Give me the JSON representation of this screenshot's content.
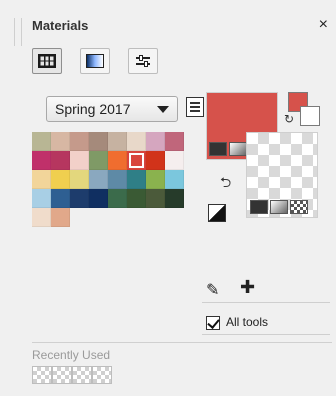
{
  "panel": {
    "title": "Materials",
    "close_label": "×"
  },
  "modes": [
    {
      "name": "swatches",
      "active": true
    },
    {
      "name": "gradient",
      "active": false
    },
    {
      "name": "adjust",
      "active": false
    }
  ],
  "palette": {
    "selected": "Spring 2017",
    "swatches": [
      "#b8b694",
      "#d7b7a3",
      "#c59a8b",
      "#a58a7b",
      "#c6b2a1",
      "#e8d8c9",
      "#d5a6bf",
      "#c0667b",
      "#c0306a",
      "#b6365f",
      "#f2d0c9",
      "#7f9a66",
      "#f06d2f",
      "#d9453d",
      "#d1331a",
      "#f5eeee",
      "#f2d59a",
      "#f0cf4f",
      "#e3d77d",
      "#8aa8bf",
      "#5e8aa6",
      "#2f7f87",
      "#8ab24e",
      "#7bc7dd",
      "#a8cfe5",
      "#2e5f92",
      "#1d3c6c",
      "#102f61",
      "#3b6b4b",
      "#3a5a34",
      "#4b5a3a",
      "#263b2a",
      "#f0dccb",
      "#e1a88a"
    ],
    "selected_index": 13
  },
  "foreground": {
    "color": "#d6524b"
  },
  "background": {
    "color": "#ffffff"
  },
  "tools": {
    "all_tools_label": "All tools",
    "all_tools_checked": true
  },
  "recent": {
    "label": "Recently Used",
    "count": 4
  }
}
